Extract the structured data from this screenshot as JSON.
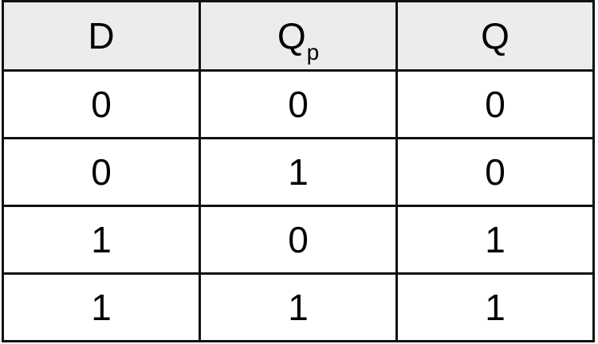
{
  "table": {
    "headers": [
      {
        "main": "D",
        "sub": ""
      },
      {
        "main": "Q",
        "sub": "p"
      },
      {
        "main": "Q",
        "sub": ""
      }
    ],
    "rows": [
      [
        "0",
        "0",
        "0"
      ],
      [
        "0",
        "1",
        "0"
      ],
      [
        "1",
        "0",
        "1"
      ],
      [
        "1",
        "1",
        "1"
      ]
    ]
  }
}
